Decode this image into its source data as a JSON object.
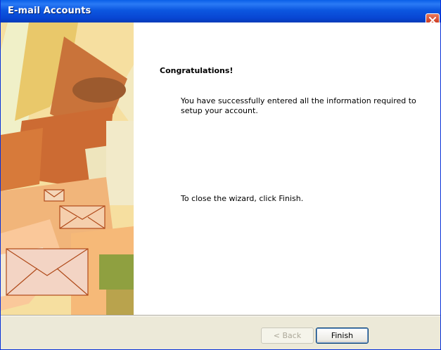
{
  "window": {
    "title": "E-mail Accounts"
  },
  "wizard": {
    "heading": "Congratulations!",
    "message": "You have successfully entered all the information required to setup your account.",
    "close_instruction": "To close the wizard, click Finish."
  },
  "buttons": {
    "back_label": "< Back",
    "finish_label": "Finish"
  },
  "icons": {
    "close": "close-icon"
  },
  "colors": {
    "titlebar": "#0846d3",
    "close_button": "#d2462b",
    "dialog_bg": "#ece9d8"
  }
}
